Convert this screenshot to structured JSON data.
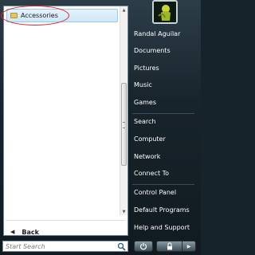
{
  "programs": {
    "items": [
      {
        "label": "Accessories",
        "icon": "folder-icon"
      }
    ],
    "back_label": "Back"
  },
  "search": {
    "placeholder": "Start Search"
  },
  "user": {
    "name": "Randal Aguilar"
  },
  "right_menu": {
    "group1": [
      "Documents",
      "Pictures",
      "Music",
      "Games"
    ],
    "group2": [
      "Search",
      "Computer",
      "Network",
      "Connect To"
    ],
    "group3": [
      "Control Panel",
      "Default Programs",
      "Help and Support"
    ]
  },
  "colors": {
    "highlight_ring": "#d8262a",
    "selection": "#cfe7f7"
  }
}
